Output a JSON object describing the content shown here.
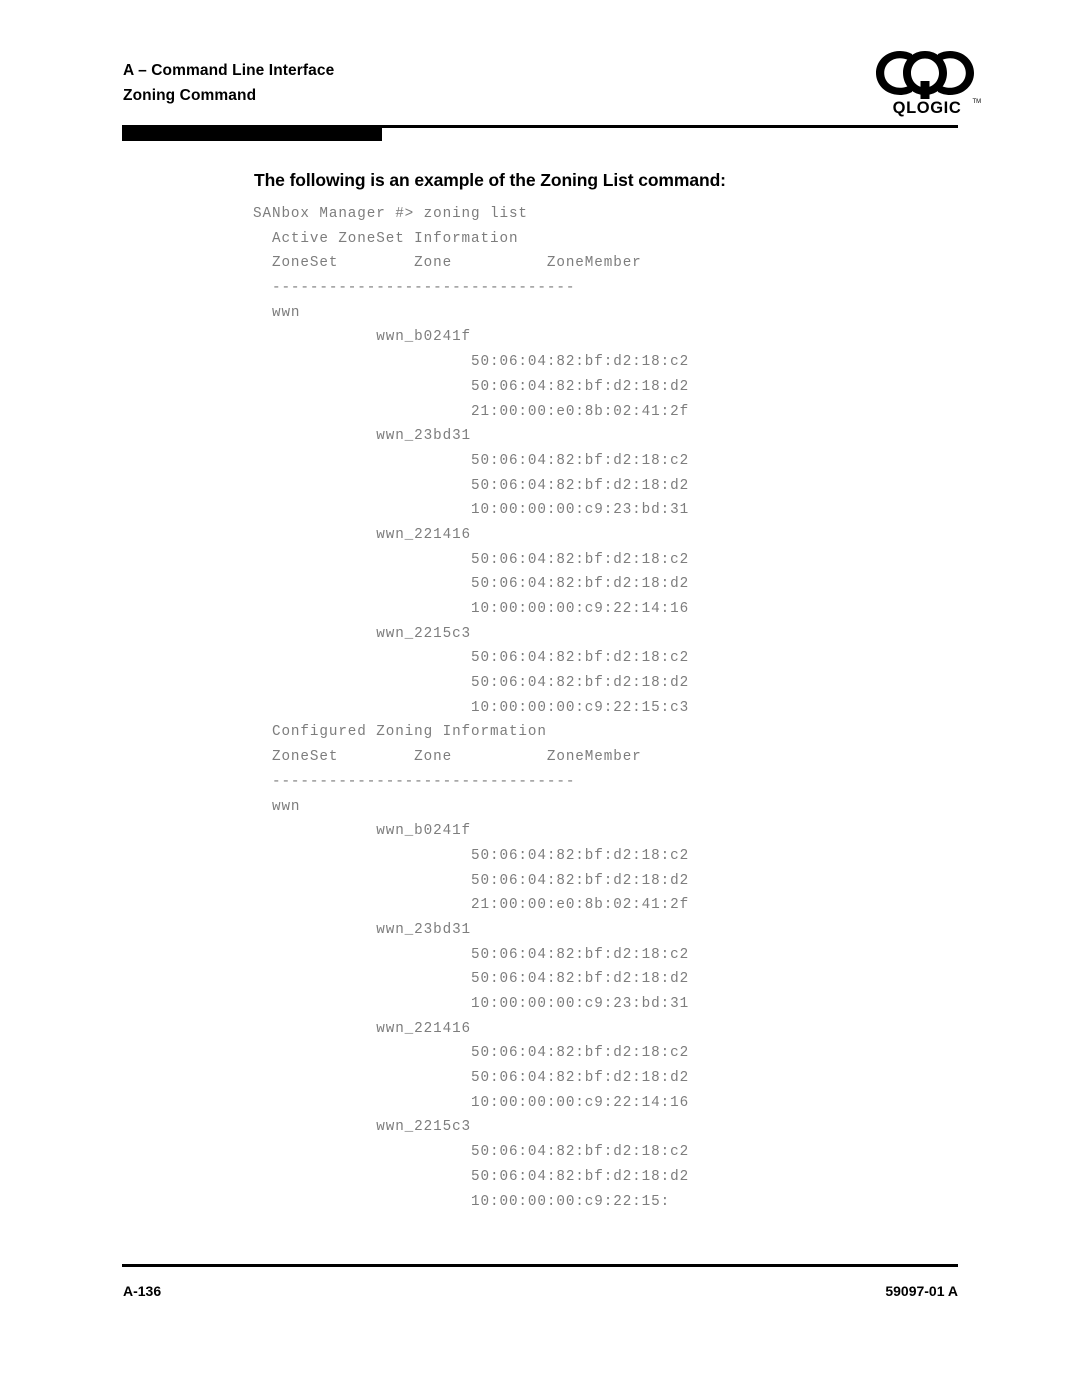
{
  "header": {
    "title_lines": [
      "A – Command Line Interface",
      "Zoning Command"
    ],
    "logo_name": "qlogic-logo",
    "logo_wordmark": "QLOGIC"
  },
  "main": {
    "section_heading": "The following is an example of the Zoning List command:",
    "code_lines": [
      "SANbox Manager #> zoning list",
      "  Active ZoneSet Information",
      "  ZoneSet        Zone          ZoneMember",
      "  --------------------------------",
      "  wwn",
      "             wwn_b0241f",
      "                       50:06:04:82:bf:d2:18:c2",
      "                       50:06:04:82:bf:d2:18:d2",
      "                       21:00:00:e0:8b:02:41:2f",
      "             wwn_23bd31",
      "                       50:06:04:82:bf:d2:18:c2",
      "                       50:06:04:82:bf:d2:18:d2",
      "                       10:00:00:00:c9:23:bd:31",
      "             wwn_221416",
      "                       50:06:04:82:bf:d2:18:c2",
      "                       50:06:04:82:bf:d2:18:d2",
      "                       10:00:00:00:c9:22:14:16",
      "             wwn_2215c3",
      "                       50:06:04:82:bf:d2:18:c2",
      "                       50:06:04:82:bf:d2:18:d2",
      "                       10:00:00:00:c9:22:15:c3",
      "  Configured Zoning Information",
      "  ZoneSet        Zone          ZoneMember",
      "  --------------------------------",
      "  wwn",
      "             wwn_b0241f",
      "                       50:06:04:82:bf:d2:18:c2",
      "                       50:06:04:82:bf:d2:18:d2",
      "                       21:00:00:e0:8b:02:41:2f",
      "             wwn_23bd31",
      "                       50:06:04:82:bf:d2:18:c2",
      "                       50:06:04:82:bf:d2:18:d2",
      "                       10:00:00:00:c9:23:bd:31",
      "             wwn_221416",
      "                       50:06:04:82:bf:d2:18:c2",
      "                       50:06:04:82:bf:d2:18:d2",
      "                       10:00:00:00:c9:22:14:16",
      "             wwn_2215c3",
      "                       50:06:04:82:bf:d2:18:c2",
      "                       50:06:04:82:bf:d2:18:d2",
      "                       10:00:00:00:c9:22:15:"
    ]
  },
  "footer": {
    "page_number": "A-136",
    "document_number": "59097-01 A"
  },
  "colors": {
    "text": "#000000",
    "code_text": "#7d7d7d",
    "rule": "#000000",
    "background": "#ffffff"
  }
}
